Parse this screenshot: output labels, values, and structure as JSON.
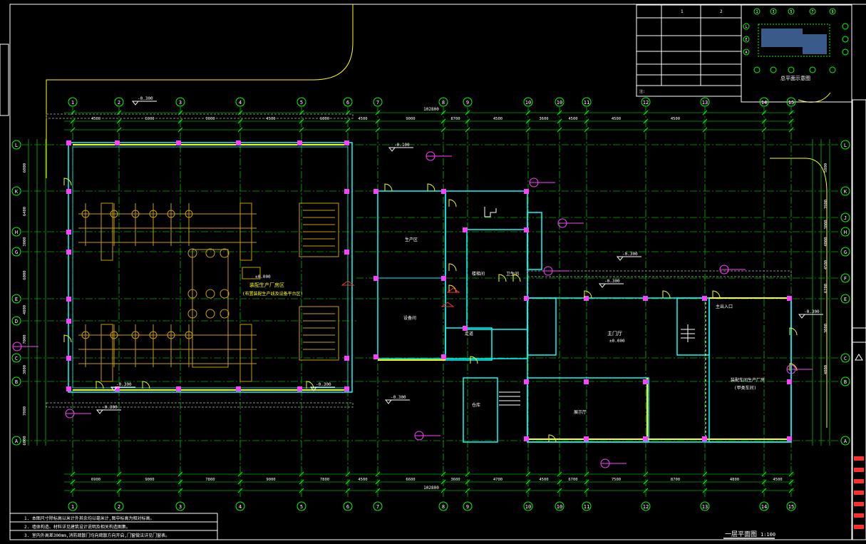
{
  "drawing": {
    "title": "一层平面图",
    "scale": "1:100",
    "colors": {
      "background": "#000000",
      "axis": "#00ff00",
      "wall": "#00ffff",
      "equipment": "#c8a000",
      "column": "#ff40ff",
      "site": "#ffff00",
      "frame": "#ffffff",
      "door": "#ffff00",
      "red": "#ff3030"
    }
  },
  "grid": {
    "columns": [
      "1",
      "2",
      "3",
      "4",
      "5",
      "6",
      "7",
      "8",
      "9",
      "10",
      "10",
      "11",
      "12",
      "13",
      "14",
      "15"
    ],
    "rows": [
      "L",
      "K",
      "H",
      "G",
      "E",
      "D",
      "C",
      "B",
      "A"
    ],
    "rows_right": [
      "L",
      "K",
      "J",
      "H",
      "G",
      "F",
      "E",
      "C",
      "B",
      "A"
    ]
  },
  "dimensions": {
    "total": "102800",
    "top": [
      "4500",
      "6000",
      "9000",
      "4500",
      "6000",
      "4500",
      "9000",
      "8700",
      "4500",
      "3600",
      "4500",
      "4500",
      "4500"
    ],
    "bottom": [
      "6900",
      "9000",
      "7800",
      "9000",
      "7800",
      "4500",
      "6600",
      "3600",
      "4700",
      "4500",
      "6700",
      "7500",
      "8700",
      "4800",
      "4500"
    ],
    "left": [
      "6000",
      "6400",
      "3000",
      "6000",
      "4000",
      "7000",
      "3000",
      "7000",
      "6000"
    ],
    "right": [
      "5800",
      "3900",
      "3000",
      "4000",
      "4500",
      "6700",
      "3000",
      "4000"
    ]
  },
  "levels": {
    "floor": "±0.000",
    "outside": [
      "-0.300",
      "-0.100",
      "-0.300",
      "-0.300",
      "-0.300",
      "-0.300",
      "-0.300",
      "-0.300"
    ]
  },
  "rooms": {
    "workshop": "装配生产厂房区",
    "workshop_note": "(布置装配生产线及设备平台区)",
    "office_main": "生产区",
    "office_mid": "设备间",
    "stair_hall": "楼梯间",
    "toilet": "卫生间",
    "corridor": "走道",
    "lobby": "主门厅",
    "lobby_level": "±0.000",
    "exhibition": "展示厅",
    "storage": "仓库",
    "entrance": "主出入口",
    "hall_right": "装配车间生产厂房",
    "hall_right_note": "(甲类车间)"
  },
  "title_block": {
    "cells": [
      "1",
      "2",
      "",
      "",
      "",
      "",
      ""
    ],
    "notes_label": "注:"
  },
  "notes": [
    "1. 本图尺寸除标高以米计外其余均以毫米计,图中标高为相对标高。",
    "2. 墙体构造、材料详见建筑设计说明及相关构造图集。",
    "3. 室内外高差300mm,消防疏散门均向疏散方向开启,门窗做法详见门窗表。"
  ],
  "key_plan": {
    "title": "总平面示意图",
    "columns": [
      "1",
      "3",
      "5",
      "7",
      "9"
    ],
    "rows": [
      "L",
      "E",
      "A"
    ]
  }
}
